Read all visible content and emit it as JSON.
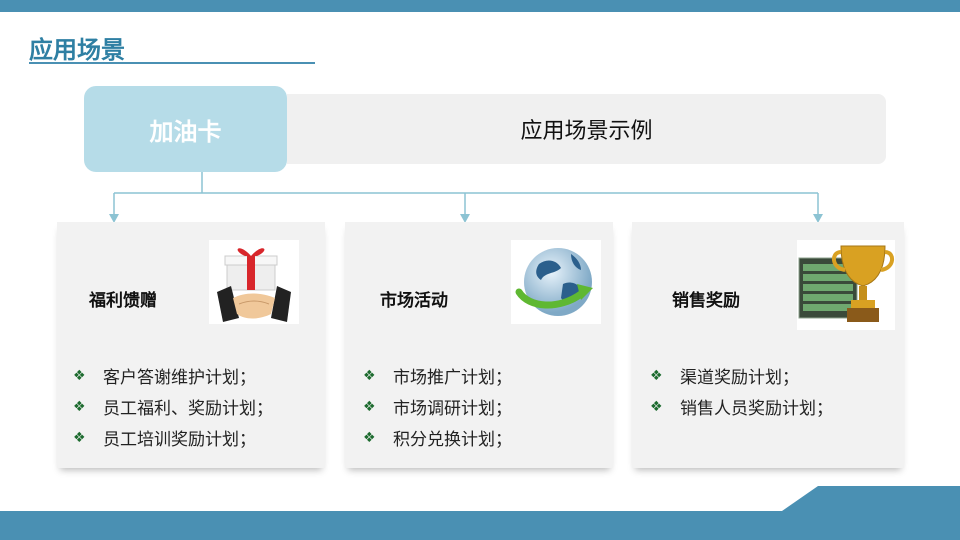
{
  "page": {
    "title": "应用场景"
  },
  "main": {
    "label": "加油卡",
    "scene_label": "应用场景示例"
  },
  "cards": [
    {
      "title": "福利馈赠",
      "icon": "gift-handshake-icon",
      "items": [
        "客户答谢维护计划；",
        "员工福利、奖励计划；",
        "员工培训奖励计划；"
      ]
    },
    {
      "title": "市场活动",
      "icon": "globe-arrow-icon",
      "items": [
        "市场推广计划；",
        "市场调研计划；",
        "积分兑换计划；"
      ]
    },
    {
      "title": "销售奖励",
      "icon": "trophy-icon",
      "items": [
        "渠道奖励计划；",
        "销售人员奖励计划；"
      ]
    }
  ],
  "bullet_glyph": "❖",
  "colors": {
    "accent": "#4a90b3",
    "title": "#2e7fa3",
    "main_box": "#b6dce8",
    "scene_bar": "#f0f0f0",
    "card": "#f2f2f2",
    "connector": "#8cc3d3",
    "bullet": "#1d6b2f"
  }
}
